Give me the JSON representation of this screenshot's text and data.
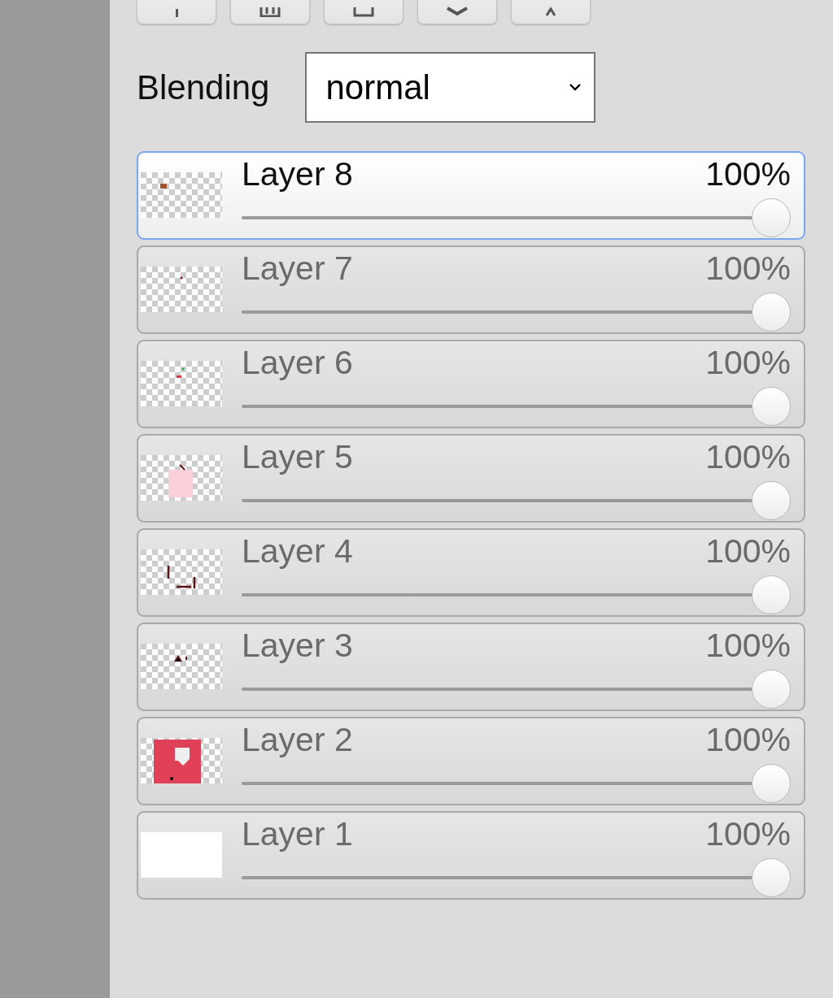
{
  "blending": {
    "label": "Blending",
    "value": "normal"
  },
  "layers": [
    {
      "name": "Layer 8",
      "opacity": "100%",
      "level": 1,
      "selected": true
    },
    {
      "name": "Layer 7",
      "opacity": "100%",
      "level": 1,
      "selected": false
    },
    {
      "name": "Layer 6",
      "opacity": "100%",
      "level": 1,
      "selected": false
    },
    {
      "name": "Layer 5",
      "opacity": "100%",
      "level": 1,
      "selected": false
    },
    {
      "name": "Layer 4",
      "opacity": "100%",
      "level": 1,
      "selected": false
    },
    {
      "name": "Layer 3",
      "opacity": "100%",
      "level": 1,
      "selected": false
    },
    {
      "name": "Layer 2",
      "opacity": "100%",
      "level": 1,
      "selected": false
    },
    {
      "name": "Layer 1",
      "opacity": "100%",
      "level": 1,
      "selected": false
    }
  ]
}
